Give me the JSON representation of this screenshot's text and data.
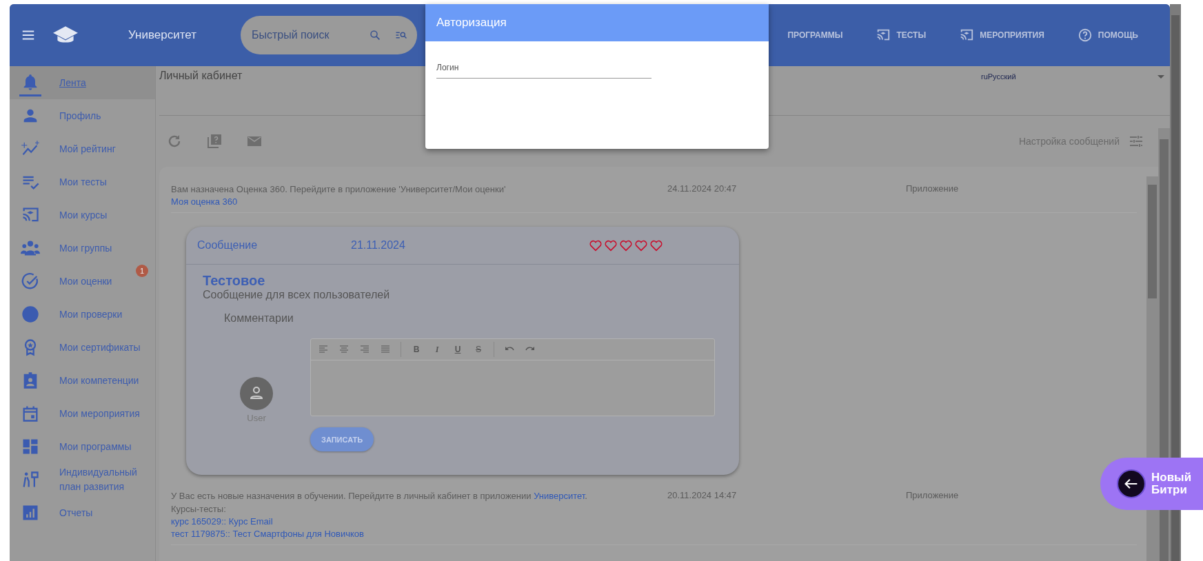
{
  "header": {
    "app_title": "Университет",
    "search": {
      "placeholder": "Быстрый поиск"
    },
    "nav": [
      {
        "label": "ПРОГРАММЫ"
      },
      {
        "label": "ТЕСТЫ"
      },
      {
        "label": "МЕРОПРИЯТИЯ"
      },
      {
        "label": "ПОМОЩЬ"
      }
    ]
  },
  "sidebar": {
    "items": [
      {
        "label": "Лента",
        "selected": true
      },
      {
        "label": "Профиль",
        "selected": false
      },
      {
        "label": "Мой рейтинг",
        "selected": false
      },
      {
        "label": "Мои тесты",
        "selected": false
      },
      {
        "label": "Мои курсы",
        "selected": false
      },
      {
        "label": "Мои группы",
        "selected": false
      },
      {
        "label": "Мои оценки",
        "selected": false,
        "badge": "1"
      },
      {
        "label": "Мои проверки",
        "selected": false
      },
      {
        "label": "Мои сертификаты",
        "selected": false
      },
      {
        "label": "Мои компетенции",
        "selected": false
      },
      {
        "label": "Мои мероприятия",
        "selected": false
      },
      {
        "label": "Мои программы",
        "selected": false
      },
      {
        "label": "Индивидуальный план развития",
        "selected": false
      },
      {
        "label": "Отчеты",
        "selected": false
      }
    ]
  },
  "page_title": "Личный кабинет",
  "language": "ruРусский",
  "settings_label": "Настройка сообщений",
  "feed": [
    {
      "kind": "notice",
      "text": "Вам назначена Оценка 360. Перейдите в приложение 'Университет/Мои оценки'",
      "link": "Моя оценка 360",
      "date": "24.11.2024 20:47",
      "source": "Приложение"
    },
    {
      "kind": "post",
      "title": "Сообщение",
      "date": "21.11.2024",
      "stars": 0,
      "heading": "Тестовое",
      "body": "Сообщение для всех пользователей",
      "comments_label": "Комментарии",
      "user": "User",
      "format_buttons": [
        "B",
        "I",
        "U",
        "S"
      ],
      "button": "ЗАПИСАТЬ"
    },
    {
      "kind": "assignment",
      "text_before": "У Вас есть новые назначения в обучении. Перейдите в личный кабинет в приложении ",
      "link": "Университет",
      "text_after": ".",
      "date": "20.11.2024 14:47",
      "source": "Приложение",
      "list_label": "Курсы-тесты:",
      "links": [
        "курс 165029:: Курс Email",
        "тест 1179875:: Тест Смартфоны для Новичков"
      ]
    }
  ],
  "dialog": {
    "title": "Авторизация",
    "field": {
      "placeholder": "Логин"
    }
  },
  "promo": {
    "lines": [
      "Новый",
      "Битри"
    ]
  }
}
